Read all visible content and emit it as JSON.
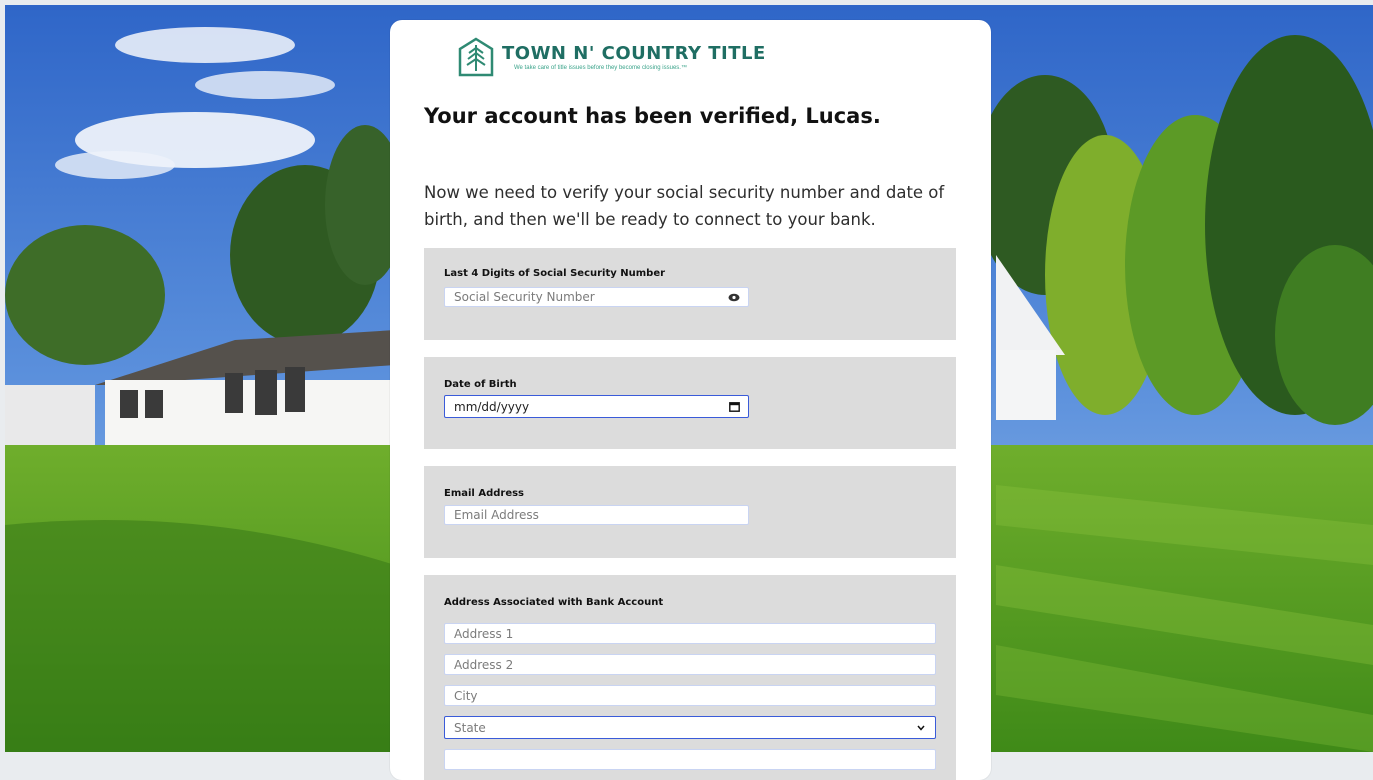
{
  "brand": {
    "name": "TOWN N' COUNTRY TITLE",
    "tagline": "We take care of title issues before they become closing issues.™"
  },
  "heading": "Your account has been verified, Lucas.",
  "lead": "Now we need to verify your social security number and date of birth, and then we'll be ready to connect to your bank.",
  "ssn": {
    "label": "Last 4 Digits of Social Security Number",
    "placeholder": "Social Security Number"
  },
  "dob": {
    "label": "Date of Birth",
    "value": "mm/dd/yyyy"
  },
  "email": {
    "label": "Email Address",
    "placeholder": "Email Address"
  },
  "address": {
    "label": "Address Associated with Bank Account",
    "address1_placeholder": "Address 1",
    "address2_placeholder": "Address 2",
    "city_placeholder": "City",
    "state_selected": "State"
  },
  "colors": {
    "brand": "#1f6e63",
    "panel": "#dcdcdc",
    "focus_border": "#3a5bd9"
  }
}
